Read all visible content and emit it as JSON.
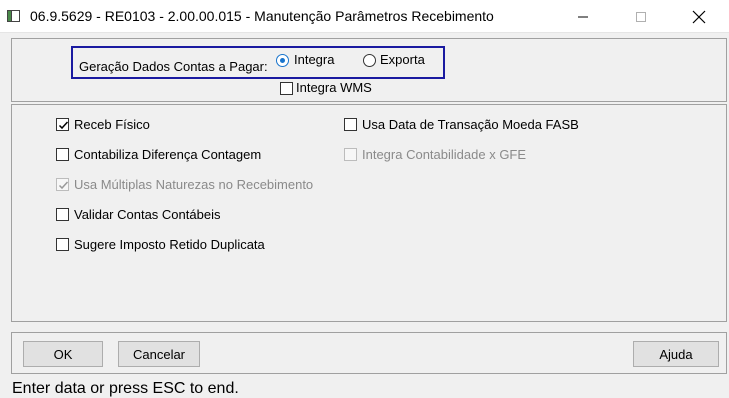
{
  "window": {
    "title": "06.9.5629 - RE0103 - 2.00.00.015 - Manutenção Parâmetros Recebimento"
  },
  "top_group": {
    "label": "Geração Dados Contas a Pagar:",
    "options": [
      "Integra",
      "Exporta"
    ],
    "selected": "Integra",
    "integra_wms_label": "Integra WMS",
    "integra_wms_checked": false
  },
  "options": {
    "receb_fisico": {
      "label": "Receb Físico",
      "checked": true,
      "enabled": true
    },
    "contabiliza_diferenca": {
      "label": "Contabiliza Diferença Contagem",
      "checked": false,
      "enabled": true
    },
    "usa_multiplas_naturezas": {
      "label": "Usa Múltiplas Naturezas no Recebimento",
      "checked": true,
      "enabled": false
    },
    "validar_contas": {
      "label": "Validar Contas Contábeis",
      "checked": false,
      "enabled": true
    },
    "sugere_imposto": {
      "label": "Sugere Imposto Retido Duplicata",
      "checked": false,
      "enabled": true
    },
    "usa_data_transacao": {
      "label": "Usa Data de Transação Moeda FASB",
      "checked": false,
      "enabled": true
    },
    "integra_contabilidade_gfe": {
      "label": "Integra Contabilidade x GFE",
      "checked": false,
      "enabled": false
    }
  },
  "buttons": {
    "ok": "OK",
    "cancelar": "Cancelar",
    "ajuda": "Ajuda"
  },
  "status_bar": {
    "text": "Enter data or press ESC to end."
  },
  "colors": {
    "accent": "#1874cd",
    "group_border": "#1a1aa0",
    "background": "#f0f0f0"
  }
}
